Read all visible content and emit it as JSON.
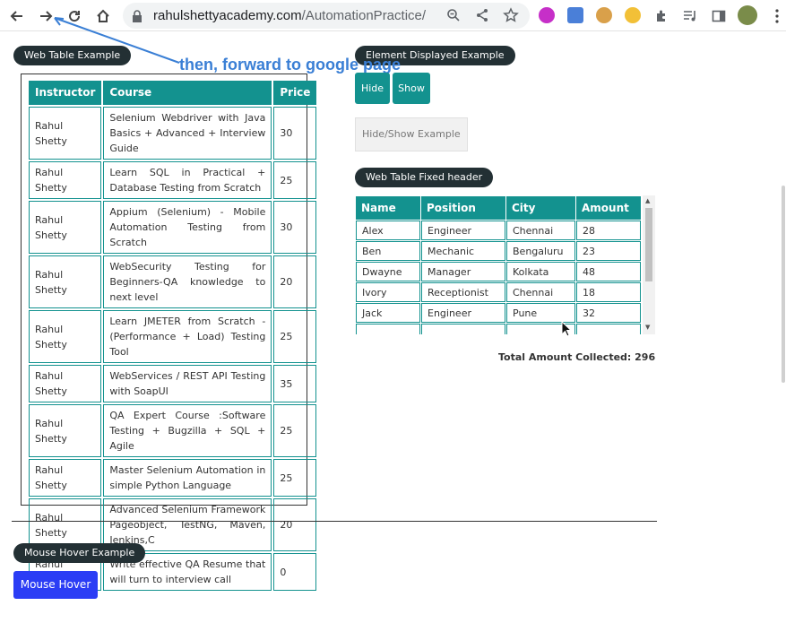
{
  "browser": {
    "url_domain": "rahulshettyacademy.com",
    "url_path": "/AutomationPractice/"
  },
  "annotation": {
    "text": "then, forward to google page"
  },
  "sections": {
    "web_table_example": "Web Table Example",
    "element_displayed_example": "Element Displayed Example",
    "web_table_fixed_header": "Web Table Fixed header",
    "mouse_hover_example": "Mouse Hover Example"
  },
  "buttons": {
    "hide": "Hide",
    "show": "Show",
    "mouse_hover": "Mouse Hover"
  },
  "hide_show_input": {
    "placeholder": "Hide/Show Example"
  },
  "course_table": {
    "headers": [
      "Instructor",
      "Course",
      "Price"
    ],
    "rows": [
      {
        "instructor": "Rahul Shetty",
        "course": "Selenium Webdriver with Java Basics + Advanced + Interview Guide",
        "price": "30"
      },
      {
        "instructor": "Rahul Shetty",
        "course": "Learn SQL in Practical + Database Testing from Scratch",
        "price": "25"
      },
      {
        "instructor": "Rahul Shetty",
        "course": "Appium (Selenium) - Mobile Automation Testing from Scratch",
        "price": "30"
      },
      {
        "instructor": "Rahul Shetty",
        "course": "WebSecurity Testing for Beginners-QA knowledge to next level",
        "price": "20"
      },
      {
        "instructor": "Rahul Shetty",
        "course": "Learn JMETER from Scratch - (Performance + Load) Testing Tool",
        "price": "25"
      },
      {
        "instructor": "Rahul Shetty",
        "course": "WebServices / REST API Testing with SoapUI",
        "price": "35"
      },
      {
        "instructor": "Rahul Shetty",
        "course": "QA Expert Course :Software Testing + Bugzilla + SQL + Agile",
        "price": "25"
      },
      {
        "instructor": "Rahul Shetty",
        "course": "Master Selenium Automation in simple Python Language",
        "price": "25"
      },
      {
        "instructor": "Rahul Shetty",
        "course": "Advanced Selenium Framework Pageobject, TestNG, Maven, Jenkins,C",
        "price": "20"
      },
      {
        "instructor": "Rahul Shetty",
        "course": "Write effective QA Resume that will turn to interview call",
        "price": "0"
      }
    ]
  },
  "fixed_table": {
    "headers": [
      "Name",
      "Position",
      "City",
      "Amount"
    ],
    "rows": [
      [
        "Alex",
        "Engineer",
        "Chennai",
        "28"
      ],
      [
        "Ben",
        "Mechanic",
        "Bengaluru",
        "23"
      ],
      [
        "Dwayne",
        "Manager",
        "Kolkata",
        "48"
      ],
      [
        "Ivory",
        "Receptionist",
        "Chennai",
        "18"
      ],
      [
        "Jack",
        "Engineer",
        "Pune",
        "32"
      ]
    ],
    "total_label": "Total Amount Collected: 296"
  },
  "colors": {
    "teal": "#13928f",
    "pill": "#233034",
    "hover_button": "#2b3df5",
    "annotation": "#3a7fd5"
  }
}
